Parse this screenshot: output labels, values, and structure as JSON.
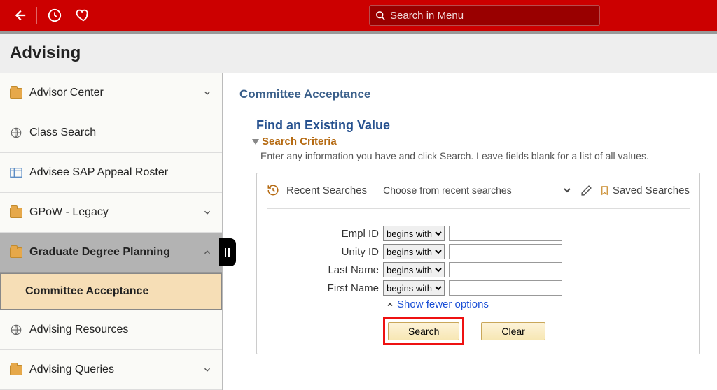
{
  "topbar": {
    "search_placeholder": "Search in Menu"
  },
  "title": "Advising",
  "sidebar": {
    "items": [
      {
        "label": "Advisor Center",
        "icon": "folder",
        "chev": "down"
      },
      {
        "label": "Class Search",
        "icon": "globe",
        "chev": ""
      },
      {
        "label": "Advisee SAP Appeal Roster",
        "icon": "table",
        "chev": ""
      },
      {
        "label": "GPoW - Legacy",
        "icon": "folder",
        "chev": "down"
      },
      {
        "label": "Graduate Degree Planning",
        "icon": "folder",
        "chev": "up",
        "active": true
      },
      {
        "label": "Committee Acceptance",
        "icon": "",
        "chev": "",
        "sub": true
      },
      {
        "label": "Advising Resources",
        "icon": "globe",
        "chev": ""
      },
      {
        "label": "Advising Queries",
        "icon": "folder",
        "chev": "down"
      }
    ]
  },
  "content": {
    "page_title": "Committee Acceptance",
    "section_title": "Find an Existing Value",
    "sub_title": "Search Criteria",
    "helper": "Enter any information you have and click Search. Leave fields blank for a list of all values.",
    "recent_label": "Recent Searches",
    "recent_placeholder": "Choose from recent searches",
    "saved_label": "Saved Searches",
    "fields": [
      {
        "label": "Empl ID",
        "op": "begins with",
        "value": ""
      },
      {
        "label": "Unity ID",
        "op": "begins with",
        "value": ""
      },
      {
        "label": "Last Name",
        "op": "begins with",
        "value": ""
      },
      {
        "label": "First Name",
        "op": "begins with",
        "value": ""
      }
    ],
    "fewer_label": "Show fewer options",
    "search_btn": "Search",
    "clear_btn": "Clear"
  }
}
